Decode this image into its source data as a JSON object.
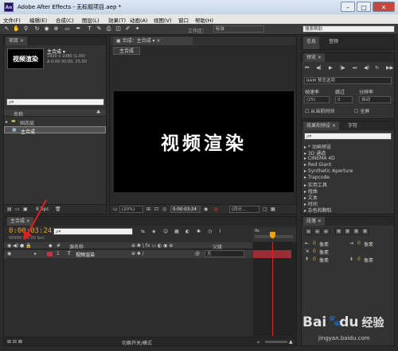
{
  "window": {
    "app_icon": "Ae",
    "title": "Adobe After Effects - 无标题项目.aep *",
    "minimize": "–",
    "maximize": "□",
    "close": "✕"
  },
  "menu": [
    "文件(F)",
    "编辑(E)",
    "合成(C)",
    "图层(L)",
    "效果(T)",
    "动画(A)",
    "视图(V)",
    "窗口",
    "帮助(H)"
  ],
  "toolbar": {
    "workspace_label": "工作区：",
    "workspace_value": "标准",
    "search_placeholder": "搜索帮助"
  },
  "project": {
    "tab": "项目 ×",
    "comp_name": "主合成 ▾",
    "comp_res": "1920 x 1080 (1.00)",
    "comp_dur": "Δ 0:00:30:00, 25.00",
    "thumb_text": "视频渲染",
    "search_placeholder": "ρ▾",
    "col_name": "名称",
    "items": [
      {
        "label": "固态层",
        "type": "folder"
      },
      {
        "label": "主合成",
        "type": "comp"
      }
    ],
    "bpc": "8 bpc"
  },
  "comp_viewer": {
    "tab_icon": "▣",
    "tab": "合成：主合成",
    "tab_close": "▾ ×",
    "sub_tab": "主合成",
    "canvas_text": "视频渲染",
    "zoom": "(20%)",
    "timecode": "0:00:03:24",
    "quality": "(四分..."
  },
  "info": {
    "tabs": [
      "信息",
      "音频"
    ]
  },
  "preview": {
    "tab": "预览 ×",
    "ram": "RAM 预览选项",
    "labels": [
      "帧速率",
      "跳过",
      "分辨率"
    ],
    "values": [
      "(25)",
      "0",
      "自动"
    ],
    "opt1": "从当前时间",
    "opt2": "全屏"
  },
  "effects": {
    "tabs": [
      "效果和预设 ×",
      "字符"
    ],
    "search_placeholder": "ρ▾",
    "items": [
      "* 动画预设",
      "3D 通道",
      "CINEMA 4D",
      "Red Giant",
      "Synthetic Aperture",
      "Trapcode",
      "实用工具",
      "扭曲",
      "文本",
      "时间",
      "杂色和颗粒"
    ]
  },
  "timeline": {
    "tab": "主合成 ×",
    "timecode": "0:00:03:24",
    "frames": "00099 (25.00 fps)",
    "search_placeholder": "ρ▾",
    "col_source": "源名称",
    "col_parent": "父级",
    "layer_num": "1",
    "layer_name": "视频渲染",
    "layer_parent": "无",
    "ruler_start": "0s",
    "bottom_label": "切换开关/模式"
  },
  "paragraph": {
    "tab": "段落 ×",
    "px_labels": [
      "像素",
      "像素",
      "像素",
      "像素",
      "像素"
    ],
    "px_values": [
      "0",
      "0",
      "0",
      "0",
      "0"
    ]
  },
  "watermark": {
    "brand1": "Bai",
    "brand2": "du",
    "brand3": "经验",
    "url": "jingyan.baidu.com"
  },
  "colors": {
    "accent": "#f4a20b",
    "annotation": "#e02020",
    "layer_label": "#c4323c"
  }
}
